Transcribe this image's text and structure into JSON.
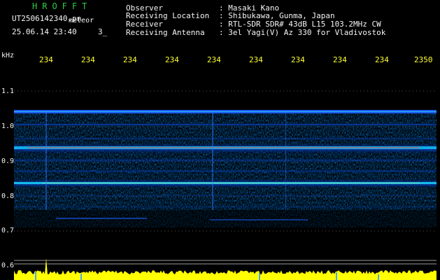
{
  "header": {
    "title": "HROFFT",
    "file": "UT2506142340.pn",
    "subtitle": "meteor",
    "datetime": "25.06.14 23:40",
    "count": "3_"
  },
  "info": [
    {
      "label": "Observer",
      "value": ": Masaki Kano"
    },
    {
      "label": "Receiving Location",
      "value": ": Shibukawa, Gunma, Japan"
    },
    {
      "label": "Receiver",
      "value": ": RTL-SDR SDR# 43dB L15 103.2MHz CW"
    },
    {
      "label": "Receiving Antenna",
      "value": ": 3el Yagi(V) Az 330 for Vladivostok"
    }
  ],
  "axis": {
    "unit": "kHz",
    "y_ticks": [
      "1.1",
      "1.0",
      "0.9",
      "0.8",
      "0.7",
      "0.6"
    ],
    "x_ticks": [
      "234",
      "234",
      "234",
      "234",
      "234",
      "234",
      "234",
      "234",
      "234",
      "2350"
    ]
  },
  "colors": {
    "background": "#000000",
    "header_title": "#2ecc40",
    "text": "#f5f5f5",
    "x_tick": "#ffff33",
    "strip": "#ffff00",
    "grid": "#555555"
  }
}
